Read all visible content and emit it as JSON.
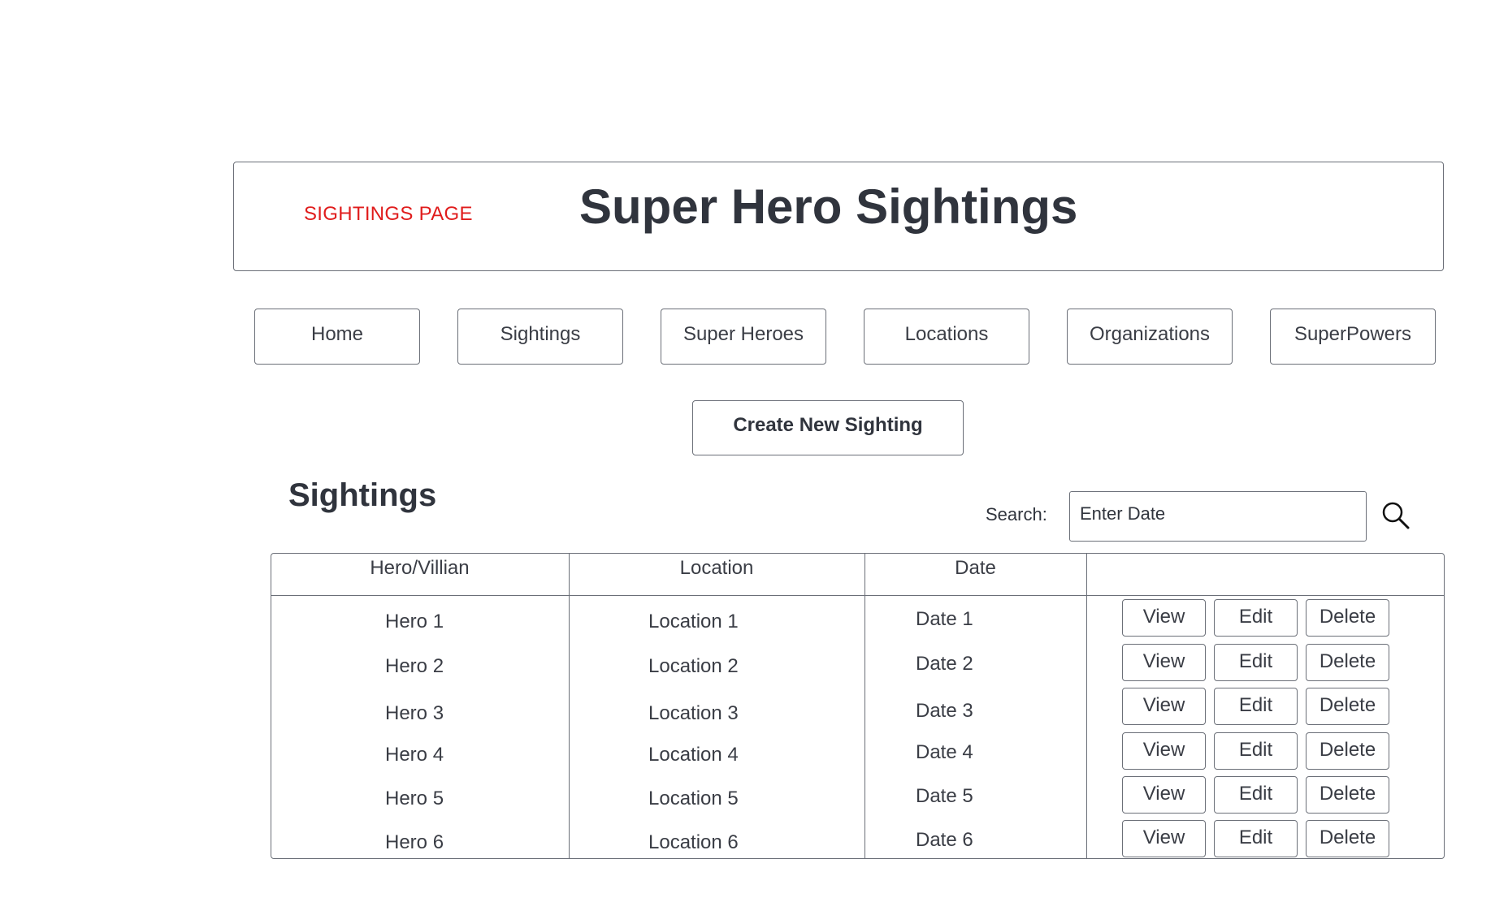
{
  "header": {
    "page_label": "SIGHTINGS PAGE",
    "title": "Super Hero Sightings"
  },
  "nav": [
    {
      "label": "Home"
    },
    {
      "label": "Sightings"
    },
    {
      "label": "Super Heroes"
    },
    {
      "label": "Locations"
    },
    {
      "label": "Organizations"
    },
    {
      "label": "SuperPowers"
    }
  ],
  "create_button": "Create New Sighting",
  "section_title": "Sightings",
  "search": {
    "label": "Search:",
    "placeholder": "Enter Date"
  },
  "table": {
    "columns": [
      "Hero/Villian",
      "Location",
      "Date",
      ""
    ],
    "rows": [
      {
        "hero": "Hero 1",
        "location": "Location 1",
        "date": "Date 1"
      },
      {
        "hero": "Hero 2",
        "location": "Location 2",
        "date": "Date 2"
      },
      {
        "hero": "Hero 3",
        "location": "Location 3",
        "date": "Date 3"
      },
      {
        "hero": "Hero 4",
        "location": "Location 4",
        "date": "Date 4"
      },
      {
        "hero": "Hero 5",
        "location": "Location 5",
        "date": "Date 5"
      },
      {
        "hero": "Hero 6",
        "location": "Location 6",
        "date": "Date 6"
      }
    ],
    "actions": {
      "view": "View",
      "edit": "Edit",
      "delete": "Delete"
    }
  },
  "colors": {
    "page_label": "#e01c1c",
    "text": "#30343d",
    "border": "#6b6f78"
  }
}
